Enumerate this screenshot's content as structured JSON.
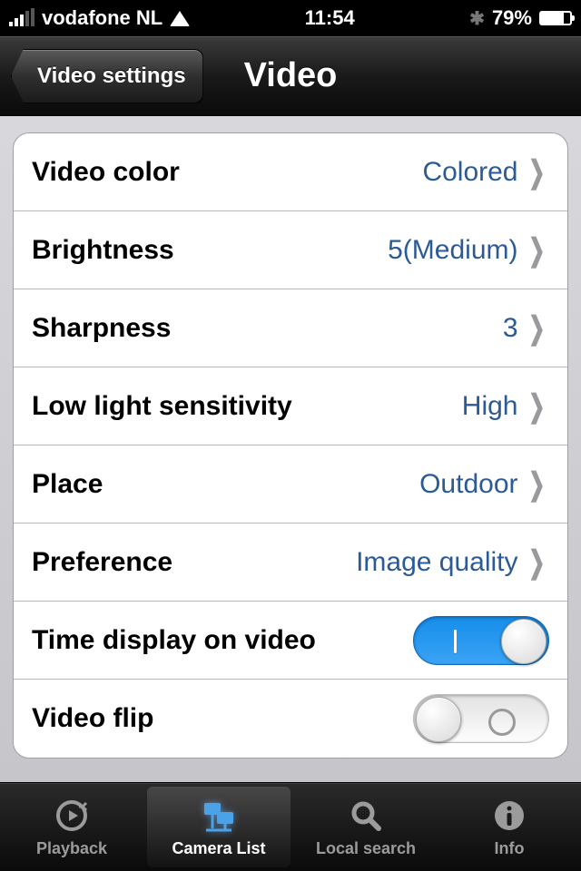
{
  "status_bar": {
    "carrier": "vodafone NL",
    "time": "11:54",
    "battery_pct": "79%"
  },
  "nav": {
    "back_label": "Video settings",
    "title": "Video"
  },
  "rows": [
    {
      "label": "Video color",
      "value": "Colored",
      "type": "chevron"
    },
    {
      "label": "Brightness",
      "value": "5(Medium)",
      "type": "chevron"
    },
    {
      "label": "Sharpness",
      "value": "3",
      "type": "chevron"
    },
    {
      "label": "Low light sensitivity",
      "value": "High",
      "type": "chevron"
    },
    {
      "label": "Place",
      "value": "Outdoor",
      "type": "chevron"
    },
    {
      "label": "Preference",
      "value": "Image quality",
      "type": "chevron"
    },
    {
      "label": "Time display on video",
      "value": "on",
      "type": "toggle"
    },
    {
      "label": "Video flip",
      "value": "off",
      "type": "toggle"
    }
  ],
  "tabs": [
    {
      "label": "Playback"
    },
    {
      "label": "Camera List"
    },
    {
      "label": "Local search"
    },
    {
      "label": "Info"
    }
  ]
}
